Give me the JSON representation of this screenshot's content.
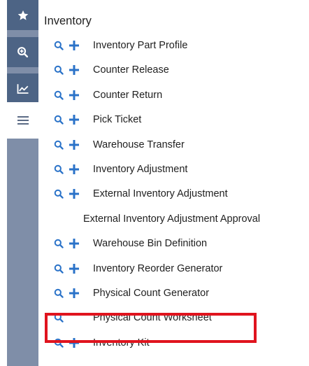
{
  "colors": {
    "rail_bg": "#7f8ea8",
    "rail_button_bg": "#4d6485",
    "accent": "#2a72c8",
    "highlight": "#e0141e"
  },
  "rail": {
    "items": [
      {
        "icon": "star-icon",
        "active": false
      },
      {
        "icon": "zoom-in-icon",
        "active": false
      },
      {
        "icon": "line-chart-icon",
        "active": false
      },
      {
        "icon": "hamburger-menu-icon",
        "active": true
      }
    ]
  },
  "menu": {
    "title": "Inventory",
    "items": [
      {
        "label": "Inventory Part Profile",
        "search": true,
        "add": true
      },
      {
        "label": "Counter Release",
        "search": true,
        "add": true
      },
      {
        "label": "Counter Return",
        "search": true,
        "add": true
      },
      {
        "label": "Pick Ticket",
        "search": true,
        "add": true
      },
      {
        "label": "Warehouse Transfer",
        "search": true,
        "add": true
      },
      {
        "label": "Inventory Adjustment",
        "search": true,
        "add": true
      },
      {
        "label": "External Inventory Adjustment",
        "search": true,
        "add": true
      },
      {
        "label": "External Inventory Adjustment Approval",
        "search": false,
        "add": false
      },
      {
        "label": "Warehouse Bin Definition",
        "search": true,
        "add": true
      },
      {
        "label": "Inventory Reorder Generator",
        "search": true,
        "add": true
      },
      {
        "label": "Physical Count Generator",
        "search": true,
        "add": true
      },
      {
        "label": "Physical Count Worksheet",
        "search": true,
        "add": false,
        "highlighted": true
      },
      {
        "label": "Inventory Kit",
        "search": true,
        "add": true
      }
    ]
  }
}
